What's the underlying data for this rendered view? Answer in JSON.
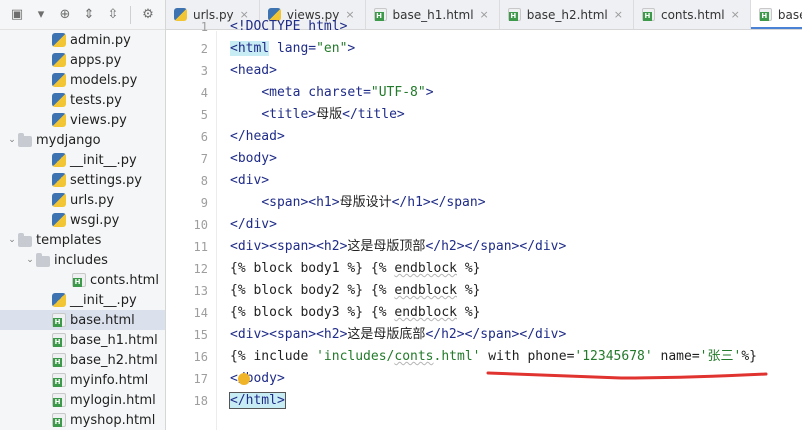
{
  "sidebar": {
    "toolbar": [
      {
        "name": "folder-icon",
        "glyph": "▣"
      },
      {
        "name": "sort-icon",
        "glyph": "▾"
      },
      {
        "name": "locate-icon",
        "glyph": "⊕"
      },
      {
        "name": "collapse-all-icon",
        "glyph": "⇕"
      },
      {
        "name": "expand-all-icon",
        "glyph": "⇳"
      },
      {
        "name": "settings-gear-icon",
        "glyph": "⚙"
      }
    ],
    "tree": [
      {
        "label": "admin.py",
        "type": "py",
        "depth": 2
      },
      {
        "label": "apps.py",
        "type": "py",
        "depth": 2
      },
      {
        "label": "models.py",
        "type": "py",
        "depth": 2
      },
      {
        "label": "tests.py",
        "type": "py",
        "depth": 2
      },
      {
        "label": "views.py",
        "type": "py",
        "depth": 2
      },
      {
        "label": "mydjango",
        "type": "folder",
        "depth": 1,
        "expanded": true
      },
      {
        "label": "__init__.py",
        "type": "py",
        "depth": 2
      },
      {
        "label": "settings.py",
        "type": "py",
        "depth": 2
      },
      {
        "label": "urls.py",
        "type": "py",
        "depth": 2
      },
      {
        "label": "wsgi.py",
        "type": "py",
        "depth": 2
      },
      {
        "label": "templates",
        "type": "folder",
        "depth": 1,
        "expanded": true
      },
      {
        "label": "includes",
        "type": "folder",
        "depth": 2,
        "expanded": true
      },
      {
        "label": "conts.html",
        "type": "html",
        "depth": 3
      },
      {
        "label": "__init__.py",
        "type": "py",
        "depth": 2
      },
      {
        "label": "base.html",
        "type": "html",
        "depth": 2,
        "selected": true
      },
      {
        "label": "base_h1.html",
        "type": "html",
        "depth": 2
      },
      {
        "label": "base_h2.html",
        "type": "html",
        "depth": 2
      },
      {
        "label": "myinfo.html",
        "type": "html",
        "depth": 2
      },
      {
        "label": "mylogin.html",
        "type": "html",
        "depth": 2
      },
      {
        "label": "myshop.html",
        "type": "html",
        "depth": 2
      }
    ]
  },
  "tabs": [
    {
      "label": "urls.py",
      "type": "py",
      "active": false
    },
    {
      "label": "views.py",
      "type": "py",
      "active": false
    },
    {
      "label": "base_h1.html",
      "type": "html",
      "active": false
    },
    {
      "label": "base_h2.html",
      "type": "html",
      "active": false
    },
    {
      "label": "conts.html",
      "type": "html",
      "active": false
    },
    {
      "label": "base.html",
      "type": "html",
      "active": true
    }
  ],
  "editor": {
    "lines": [
      {
        "num": "1",
        "text": "<!DOCTYPE html>"
      },
      {
        "num": "2",
        "text": "<html lang=\"en\">"
      },
      {
        "num": "3",
        "text": "<head>"
      },
      {
        "num": "4",
        "text": "    <meta charset=\"UTF-8\">"
      },
      {
        "num": "5",
        "text": "    <title>母版</title>"
      },
      {
        "num": "6",
        "text": "</head>"
      },
      {
        "num": "7",
        "text": "<body>"
      },
      {
        "num": "8",
        "text": "<div>"
      },
      {
        "num": "9",
        "text": "    <span><h1>母版设计</h1></span>"
      },
      {
        "num": "10",
        "text": "</div>"
      },
      {
        "num": "11",
        "text": "<div><span><h2>这是母版顶部</h2></span></div>"
      },
      {
        "num": "12",
        "text": "{% block body1 %} {% endblock %}"
      },
      {
        "num": "13",
        "text": "{% block body2 %} {% endblock %}"
      },
      {
        "num": "14",
        "text": "{% block body3 %} {% endblock %}"
      },
      {
        "num": "15",
        "text": "<div><span><h2>这是母版底部</h2></span></div>"
      },
      {
        "num": "16",
        "text": "{% include 'includes/conts.html' with phone='12345678' name='张三'%}"
      },
      {
        "num": "17",
        "text": "</body>"
      },
      {
        "num": "18",
        "text": "</html>"
      }
    ]
  },
  "colors": {
    "annotation": "#e0322f",
    "bulb": "#f0b429",
    "tab_accent": "#4a82d6"
  }
}
